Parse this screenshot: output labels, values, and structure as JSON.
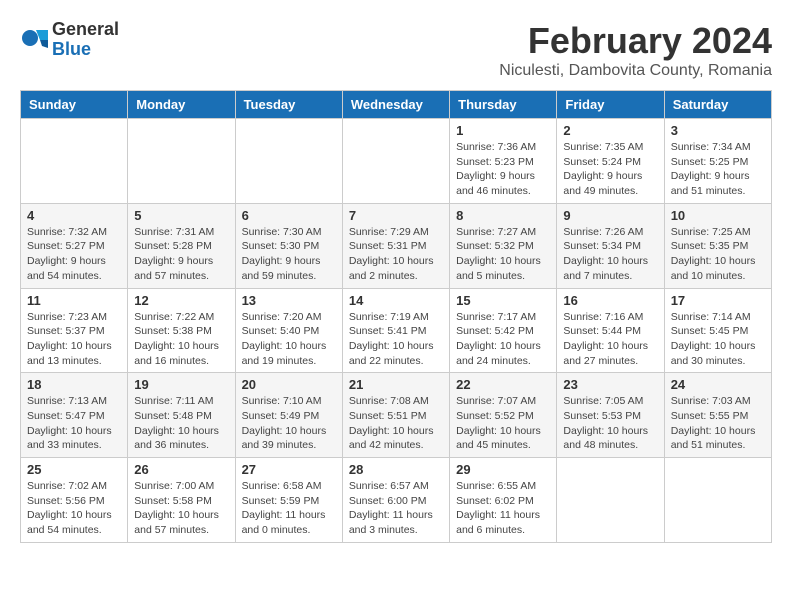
{
  "logo": {
    "general": "General",
    "blue": "Blue"
  },
  "title": "February 2024",
  "location": "Niculesti, Dambovita County, Romania",
  "days_of_week": [
    "Sunday",
    "Monday",
    "Tuesday",
    "Wednesday",
    "Thursday",
    "Friday",
    "Saturday"
  ],
  "weeks": [
    [
      {
        "day": "",
        "info": ""
      },
      {
        "day": "",
        "info": ""
      },
      {
        "day": "",
        "info": ""
      },
      {
        "day": "",
        "info": ""
      },
      {
        "day": "1",
        "info": "Sunrise: 7:36 AM\nSunset: 5:23 PM\nDaylight: 9 hours\nand 46 minutes."
      },
      {
        "day": "2",
        "info": "Sunrise: 7:35 AM\nSunset: 5:24 PM\nDaylight: 9 hours\nand 49 minutes."
      },
      {
        "day": "3",
        "info": "Sunrise: 7:34 AM\nSunset: 5:25 PM\nDaylight: 9 hours\nand 51 minutes."
      }
    ],
    [
      {
        "day": "4",
        "info": "Sunrise: 7:32 AM\nSunset: 5:27 PM\nDaylight: 9 hours\nand 54 minutes."
      },
      {
        "day": "5",
        "info": "Sunrise: 7:31 AM\nSunset: 5:28 PM\nDaylight: 9 hours\nand 57 minutes."
      },
      {
        "day": "6",
        "info": "Sunrise: 7:30 AM\nSunset: 5:30 PM\nDaylight: 9 hours\nand 59 minutes."
      },
      {
        "day": "7",
        "info": "Sunrise: 7:29 AM\nSunset: 5:31 PM\nDaylight: 10 hours\nand 2 minutes."
      },
      {
        "day": "8",
        "info": "Sunrise: 7:27 AM\nSunset: 5:32 PM\nDaylight: 10 hours\nand 5 minutes."
      },
      {
        "day": "9",
        "info": "Sunrise: 7:26 AM\nSunset: 5:34 PM\nDaylight: 10 hours\nand 7 minutes."
      },
      {
        "day": "10",
        "info": "Sunrise: 7:25 AM\nSunset: 5:35 PM\nDaylight: 10 hours\nand 10 minutes."
      }
    ],
    [
      {
        "day": "11",
        "info": "Sunrise: 7:23 AM\nSunset: 5:37 PM\nDaylight: 10 hours\nand 13 minutes."
      },
      {
        "day": "12",
        "info": "Sunrise: 7:22 AM\nSunset: 5:38 PM\nDaylight: 10 hours\nand 16 minutes."
      },
      {
        "day": "13",
        "info": "Sunrise: 7:20 AM\nSunset: 5:40 PM\nDaylight: 10 hours\nand 19 minutes."
      },
      {
        "day": "14",
        "info": "Sunrise: 7:19 AM\nSunset: 5:41 PM\nDaylight: 10 hours\nand 22 minutes."
      },
      {
        "day": "15",
        "info": "Sunrise: 7:17 AM\nSunset: 5:42 PM\nDaylight: 10 hours\nand 24 minutes."
      },
      {
        "day": "16",
        "info": "Sunrise: 7:16 AM\nSunset: 5:44 PM\nDaylight: 10 hours\nand 27 minutes."
      },
      {
        "day": "17",
        "info": "Sunrise: 7:14 AM\nSunset: 5:45 PM\nDaylight: 10 hours\nand 30 minutes."
      }
    ],
    [
      {
        "day": "18",
        "info": "Sunrise: 7:13 AM\nSunset: 5:47 PM\nDaylight: 10 hours\nand 33 minutes."
      },
      {
        "day": "19",
        "info": "Sunrise: 7:11 AM\nSunset: 5:48 PM\nDaylight: 10 hours\nand 36 minutes."
      },
      {
        "day": "20",
        "info": "Sunrise: 7:10 AM\nSunset: 5:49 PM\nDaylight: 10 hours\nand 39 minutes."
      },
      {
        "day": "21",
        "info": "Sunrise: 7:08 AM\nSunset: 5:51 PM\nDaylight: 10 hours\nand 42 minutes."
      },
      {
        "day": "22",
        "info": "Sunrise: 7:07 AM\nSunset: 5:52 PM\nDaylight: 10 hours\nand 45 minutes."
      },
      {
        "day": "23",
        "info": "Sunrise: 7:05 AM\nSunset: 5:53 PM\nDaylight: 10 hours\nand 48 minutes."
      },
      {
        "day": "24",
        "info": "Sunrise: 7:03 AM\nSunset: 5:55 PM\nDaylight: 10 hours\nand 51 minutes."
      }
    ],
    [
      {
        "day": "25",
        "info": "Sunrise: 7:02 AM\nSunset: 5:56 PM\nDaylight: 10 hours\nand 54 minutes."
      },
      {
        "day": "26",
        "info": "Sunrise: 7:00 AM\nSunset: 5:58 PM\nDaylight: 10 hours\nand 57 minutes."
      },
      {
        "day": "27",
        "info": "Sunrise: 6:58 AM\nSunset: 5:59 PM\nDaylight: 11 hours\nand 0 minutes."
      },
      {
        "day": "28",
        "info": "Sunrise: 6:57 AM\nSunset: 6:00 PM\nDaylight: 11 hours\nand 3 minutes."
      },
      {
        "day": "29",
        "info": "Sunrise: 6:55 AM\nSunset: 6:02 PM\nDaylight: 11 hours\nand 6 minutes."
      },
      {
        "day": "",
        "info": ""
      },
      {
        "day": "",
        "info": ""
      }
    ]
  ]
}
